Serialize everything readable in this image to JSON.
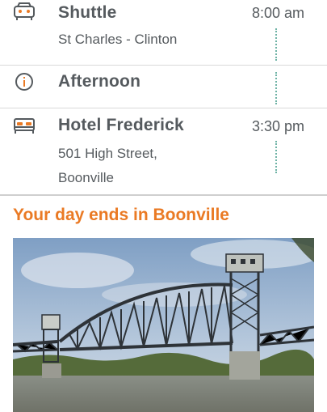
{
  "items": [
    {
      "icon": "car-icon",
      "title": "Shuttle",
      "time": "8:00 am",
      "subtitle": [
        "St Charles - Clinton"
      ]
    },
    {
      "icon": "info-icon",
      "title": "Afternoon",
      "time": "",
      "subtitle": []
    },
    {
      "icon": "bed-icon",
      "title": "Hotel Frederick",
      "time": "3:30 pm",
      "subtitle": [
        "501 High Street,",
        "Boonville"
      ]
    }
  ],
  "section": {
    "headline": "Your day ends in Boonville"
  },
  "colors": {
    "accent": "#ea7a24",
    "dots": "#6fb3a6",
    "text": "#555a5e"
  }
}
